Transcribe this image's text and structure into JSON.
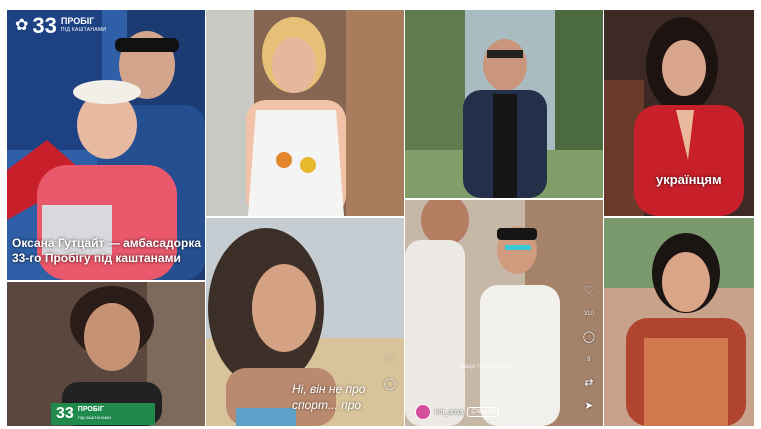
{
  "tile1": {
    "logo_number": "33",
    "logo_word": "ПРОБІГ",
    "logo_sub": "ПІД КАШТАНАМИ",
    "caption": "Оксана Гутцайт — амбасадорка 33-го Пробігу під каштанами"
  },
  "tile2": {
    "badge_number": "33",
    "badge_word": "ПРОБІГ",
    "badge_sub": "ПІД КАШТАНАМИ"
  },
  "tile4": {
    "subtitle_line1": "Ні, він не про",
    "subtitle_line2": "спорт... про"
  },
  "tile7": {
    "overlay_word": "українцям"
  },
  "tile6": {
    "likes": "310",
    "comments": "9",
    "username": "kot_anya",
    "follow_label": "Стежити",
    "blurred_caption": "якщо ти вболіваєш..."
  },
  "colors": {
    "badge_green": "#1f8a4c",
    "brand_blue": "#2f5fa6",
    "accent_red": "#c8202a"
  },
  "icons": [
    "chestnut-leaf-icon",
    "heart-icon",
    "comment-icon",
    "repost-icon",
    "send-icon"
  ]
}
